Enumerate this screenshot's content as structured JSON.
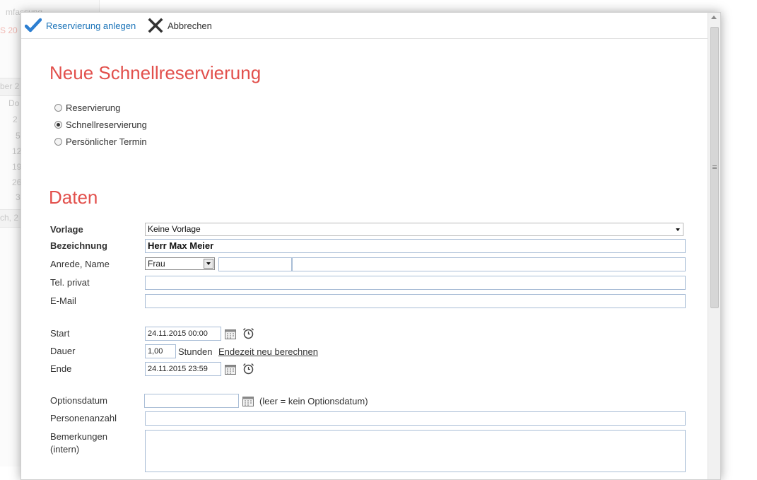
{
  "background": {
    "fragments": [
      "mfassung",
      "S 20",
      "ber 2",
      "Do",
      "2",
      "5",
      "12",
      "19",
      "26",
      "3",
      "ch, 2"
    ]
  },
  "toolbar": {
    "create_label": "Reservierung anlegen",
    "cancel_label": "Abbrechen"
  },
  "colors": {
    "accent": "#e2504c",
    "link": "#1a73b8",
    "field_border": "#a9bdd6"
  },
  "title": "Neue Schnellreservierung",
  "reservation_types": [
    {
      "label": "Reservierung",
      "checked": false
    },
    {
      "label": "Schnellreservierung",
      "checked": true
    },
    {
      "label": "Persönlicher Termin",
      "checked": false
    }
  ],
  "section_title": "Daten",
  "form": {
    "template": {
      "label": "Vorlage",
      "value": "Keine Vorlage"
    },
    "designation": {
      "label": "Bezeichnung",
      "value": "Herr Max Meier"
    },
    "salutation": {
      "label": "Anrede, Name",
      "value": "Frau",
      "first_name": "",
      "last_name": ""
    },
    "phone": {
      "label": "Tel. privat",
      "value": ""
    },
    "email": {
      "label": "E-Mail",
      "value": ""
    },
    "start": {
      "label": "Start",
      "value": "24.11.2015 00:00"
    },
    "duration": {
      "label": "Dauer",
      "value": "1,00",
      "unit": "Stunden",
      "link": "Endezeit neu berechnen"
    },
    "end": {
      "label": "Ende",
      "value": "24.11.2015 23:59"
    },
    "option_date": {
      "label": "Optionsdatum",
      "value": "",
      "hint": "(leer = kein Optionsdatum)"
    },
    "persons": {
      "label": "Personenanzahl",
      "value": ""
    },
    "remarks": {
      "label": "Bemerkungen",
      "label2": "(intern)",
      "value": ""
    }
  }
}
